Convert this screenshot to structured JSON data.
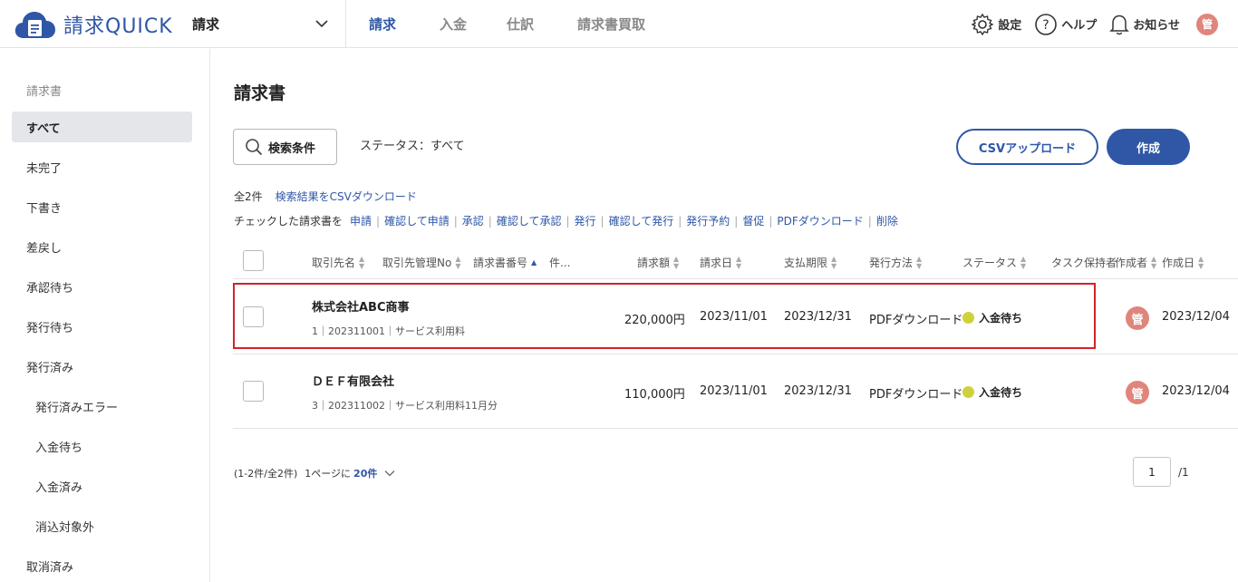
{
  "header": {
    "logo_text": "請求QUICK",
    "app_select": "請求",
    "nav": [
      {
        "label": "請求",
        "active": true
      },
      {
        "label": "入金",
        "active": false
      },
      {
        "label": "仕訳",
        "active": false
      },
      {
        "label": "請求書買取",
        "active": false
      }
    ],
    "settings_label": "設定",
    "help_label": "ヘルプ",
    "notifications_label": "お知らせ",
    "user_avatar": "管"
  },
  "sidebar": {
    "heading": "請求書",
    "items": [
      {
        "label": "すべて",
        "active": true,
        "sub": false
      },
      {
        "label": "未完了",
        "active": false,
        "sub": false
      },
      {
        "label": "下書き",
        "active": false,
        "sub": false
      },
      {
        "label": "差戻し",
        "active": false,
        "sub": false
      },
      {
        "label": "承認待ち",
        "active": false,
        "sub": false
      },
      {
        "label": "発行待ち",
        "active": false,
        "sub": false
      },
      {
        "label": "発行済み",
        "active": false,
        "sub": false
      },
      {
        "label": "発行済みエラー",
        "active": false,
        "sub": true
      },
      {
        "label": "入金待ち",
        "active": false,
        "sub": true
      },
      {
        "label": "入金済み",
        "active": false,
        "sub": true
      },
      {
        "label": "消込対象外",
        "active": false,
        "sub": true
      },
      {
        "label": "取消済み",
        "active": false,
        "sub": false
      }
    ]
  },
  "main": {
    "title": "請求書",
    "search_button": "検索条件",
    "status_filter": "ステータス：すべて",
    "csv_upload_button": "CSVアップロード",
    "create_button": "作成",
    "count_text": "全2件",
    "csv_download_link": "検索結果をCSVダウンロード",
    "checked_label": "チェックした請求書を",
    "actions": [
      "申請",
      "確認して申請",
      "承認",
      "確認して承認",
      "発行",
      "確認して発行",
      "発行予約",
      "督促",
      "PDFダウンロード",
      "削除"
    ],
    "columns": {
      "partner": "取引先名",
      "partner_code": "取引先管理No",
      "invoice_no": "請求書番号",
      "subject": "件...",
      "amount": "請求額",
      "invoice_date": "請求日",
      "due_date": "支払期限",
      "method": "発行方法",
      "status": "ステータス",
      "assignee": "タスク保持者",
      "creator": "作成者",
      "created": "作成日"
    },
    "rows": [
      {
        "partner": "株式会社ABC商事",
        "meta": "1｜202311001｜サービス利用料",
        "amount": "220,000円",
        "invoice_date": "2023/11/01",
        "due_date": "2023/12/31",
        "method": "PDFダウンロード",
        "status": "入金待ち",
        "creator": "管",
        "created": "2023/12/04",
        "highlighted": true
      },
      {
        "partner": "ＤＥＦ有限会社",
        "meta": "3｜202311002｜サービス利用料11月分",
        "amount": "110,000円",
        "invoice_date": "2023/11/01",
        "due_date": "2023/12/31",
        "method": "PDFダウンロード",
        "status": "入金待ち",
        "creator": "管",
        "created": "2023/12/04",
        "highlighted": false
      }
    ],
    "pager": {
      "range_text": "(1-2件/全2件)",
      "per_page_label": "1ページに",
      "per_page_value": "20件",
      "current_page": "1",
      "total_pages": "/1"
    }
  },
  "colors": {
    "brand": "#2f57a6",
    "highlight_border": "#d2232a",
    "status_dot": "#cdd23a",
    "avatar": "#e0857b"
  }
}
